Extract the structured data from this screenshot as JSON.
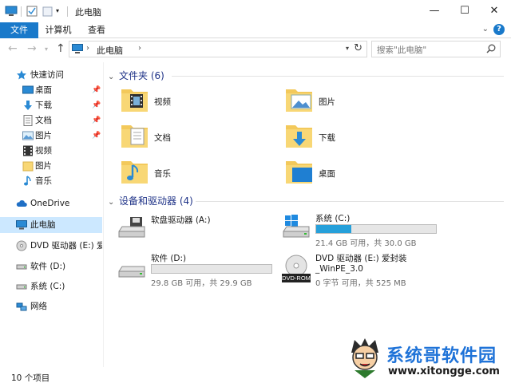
{
  "window": {
    "title": "此电脑",
    "controls": {
      "minimize": "—",
      "maximize": "☐",
      "close": "✕"
    }
  },
  "ribbon": {
    "tabs": [
      "文件",
      "计算机",
      "查看"
    ],
    "expand": "⌄",
    "help": "?"
  },
  "address": {
    "path": "此电脑",
    "search_placeholder": "搜索\"此电脑\""
  },
  "nav": {
    "items": [
      {
        "label": "快速访问",
        "icon": "star-icon",
        "pinned": false
      },
      {
        "label": "桌面",
        "icon": "desktop-icon",
        "pinned": true
      },
      {
        "label": "下载",
        "icon": "download-icon",
        "pinned": true
      },
      {
        "label": "文档",
        "icon": "document-icon",
        "pinned": true
      },
      {
        "label": "图片",
        "icon": "picture-icon",
        "pinned": true
      },
      {
        "label": "视频",
        "icon": "video-icon",
        "pinned": false
      },
      {
        "label": "图片",
        "icon": "folder-icon",
        "pinned": false
      },
      {
        "label": "音乐",
        "icon": "music-icon",
        "pinned": false
      },
      {
        "label": "OneDrive",
        "icon": "cloud-icon",
        "pinned": false
      },
      {
        "label": "此电脑",
        "icon": "computer-icon",
        "pinned": false
      },
      {
        "label": "DVD 驱动器 (E:) 爱",
        "icon": "dvd-icon",
        "pinned": false
      },
      {
        "label": "软件 (D:)",
        "icon": "drive-icon",
        "pinned": false
      },
      {
        "label": "系统 (C:)",
        "icon": "drive-icon",
        "pinned": false
      },
      {
        "label": "网络",
        "icon": "network-icon",
        "pinned": false
      }
    ]
  },
  "folders": {
    "header": "文件夹 (6)",
    "items": [
      {
        "label": "视频",
        "icon": "video-folder-icon"
      },
      {
        "label": "图片",
        "icon": "pictures-folder-icon"
      },
      {
        "label": "文档",
        "icon": "documents-folder-icon"
      },
      {
        "label": "下载",
        "icon": "downloads-folder-icon"
      },
      {
        "label": "音乐",
        "icon": "music-folder-icon"
      },
      {
        "label": "桌面",
        "icon": "desktop-folder-icon"
      }
    ]
  },
  "devices": {
    "header": "设备和驱动器 (4)",
    "items": [
      {
        "name": "软盘驱动器 (A:)",
        "icon": "floppy-drive-icon",
        "info": "",
        "fill": null
      },
      {
        "name": "系统 (C:)",
        "icon": "system-drive-icon",
        "info": "21.4 GB 可用，共 30.0 GB",
        "fill": 0.29
      },
      {
        "name": "软件 (D:)",
        "icon": "local-drive-icon",
        "info": "29.8 GB 可用，共 29.9 GB",
        "fill": 0.0
      },
      {
        "name": "DVD 驱动器 (E:) 爱封装\n_WinPE_3.0",
        "name_line1": "DVD 驱动器 (E:) 爱封装",
        "name_line2": "_WinPE_3.0",
        "icon": "dvd-rom-icon",
        "icon_text": "DVD-ROM",
        "info": "0 字节 可用，共 525 MB",
        "fill": null
      }
    ]
  },
  "status": {
    "item_count": "10 个项目"
  },
  "watermark": {
    "title": "系统哥软件园",
    "url": "www.xitongge.com"
  },
  "colors": {
    "accent": "#1979ca",
    "drive_fill": "#26a0da",
    "group_header": "#1e3287",
    "selection": "#cce8ff"
  }
}
